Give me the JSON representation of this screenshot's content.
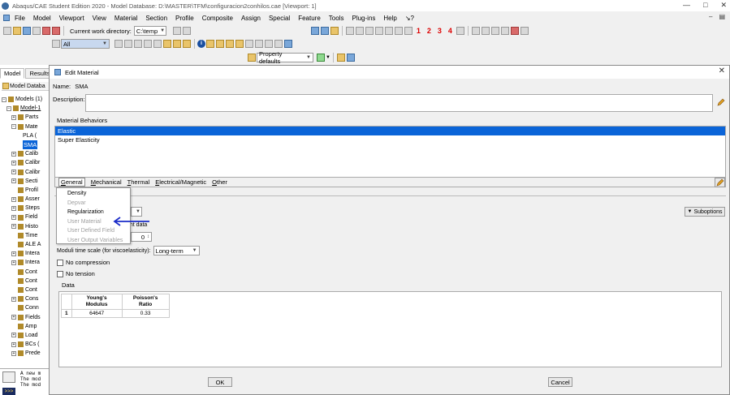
{
  "window": {
    "title": "Abaqus/CAE Student Edition 2020 - Model Database: D:\\MASTER\\TFM\\configuracion2conhilos.cae [Viewport: 1]"
  },
  "menu": [
    "File",
    "Model",
    "Viewport",
    "View",
    "Material",
    "Section",
    "Profile",
    "Composite",
    "Assign",
    "Special",
    "Feature",
    "Tools",
    "Plug-ins",
    "Help",
    "↘?"
  ],
  "toolbar": {
    "workdir_label": "Current work directory:",
    "workdir_value": "C:\\temp",
    "filter_value": "All",
    "property_defaults": "Property defaults",
    "view_numbers": [
      "1",
      "2",
      "3",
      "4"
    ]
  },
  "left_panel": {
    "tabs": [
      "Model",
      "Results"
    ],
    "header": "Model Databa",
    "tree": [
      {
        "pm": "−",
        "label": "Models (1)",
        "indent": 0
      },
      {
        "pm": "−",
        "label": "Model-1",
        "indent": 1
      },
      {
        "pm": "+",
        "label": "Parts",
        "indent": 2
      },
      {
        "pm": "−",
        "label": "Mate",
        "indent": 2
      },
      {
        "pm": "",
        "label": "PLA (",
        "indent": 3
      },
      {
        "pm": "",
        "label": "SMA",
        "indent": 3,
        "selected": true
      },
      {
        "pm": "+",
        "label": "Calib",
        "indent": 2
      },
      {
        "pm": "+",
        "label": "Calibr",
        "indent": 2
      },
      {
        "pm": "+",
        "label": "Calibr",
        "indent": 2
      },
      {
        "pm": "+",
        "label": "Secti",
        "indent": 2
      },
      {
        "pm": "",
        "label": "Profil",
        "indent": 2
      },
      {
        "pm": "+",
        "label": "Asser",
        "indent": 2
      },
      {
        "pm": "+",
        "label": "Steps",
        "indent": 2
      },
      {
        "pm": "+",
        "label": "Field",
        "indent": 2
      },
      {
        "pm": "+",
        "label": "Histo",
        "indent": 2
      },
      {
        "pm": "",
        "label": "Time",
        "indent": 2
      },
      {
        "pm": "",
        "label": "ALE A",
        "indent": 2
      },
      {
        "pm": "+",
        "label": "Intera",
        "indent": 2
      },
      {
        "pm": "+",
        "label": "Intera",
        "indent": 2
      },
      {
        "pm": "",
        "label": "Cont",
        "indent": 2
      },
      {
        "pm": "",
        "label": "Cont",
        "indent": 2
      },
      {
        "pm": "",
        "label": "Cont",
        "indent": 2
      },
      {
        "pm": "+",
        "label": "Cons",
        "indent": 2
      },
      {
        "pm": "",
        "label": "Conn",
        "indent": 2
      },
      {
        "pm": "+",
        "label": "Fields",
        "indent": 2
      },
      {
        "pm": "",
        "label": "Amp",
        "indent": 2
      },
      {
        "pm": "+",
        "label": "Load",
        "indent": 2
      },
      {
        "pm": "+",
        "label": "BCs (",
        "indent": 2
      },
      {
        "pm": "+",
        "label": "Prede",
        "indent": 2
      }
    ],
    "message_lines": [
      "A new m",
      "The mod",
      "The mod"
    ]
  },
  "dialog": {
    "title": "Edit Material",
    "name_label": "Name:",
    "name_value": "SMA",
    "description_label": "Description:",
    "behaviors_label": "Material Behaviors",
    "behaviors": [
      {
        "label": "Elastic",
        "selected": true
      },
      {
        "label": "Super Elasticity",
        "selected": false
      }
    ],
    "menus": [
      {
        "pre": "",
        "u": "G",
        "post": "eneral"
      },
      {
        "pre": "",
        "u": "M",
        "post": "echanical"
      },
      {
        "pre": "",
        "u": "T",
        "post": "hermal"
      },
      {
        "pre": "",
        "u": "E",
        "post": "lectrical/Magnetic"
      },
      {
        "pre": "",
        "u": "O",
        "post": "ther"
      }
    ],
    "general_dropdown": [
      {
        "label": "Density",
        "enabled": true
      },
      {
        "label": "Depvar",
        "enabled": false
      },
      {
        "label": "Regularization",
        "enabled": true
      },
      {
        "label": "User Material",
        "enabled": false
      },
      {
        "label": "User Defined Field",
        "enabled": false
      },
      {
        "label": "User Output Variables",
        "enabled": false
      }
    ],
    "partial_text": "ent data",
    "spin_value": "0",
    "suboptions_label": "Suboptions",
    "moduli_label": "Moduli time scale (for viscoelasticity):",
    "moduli_value": "Long-term",
    "no_compression": "No compression",
    "no_tension": "No tension",
    "data_label": "Data",
    "table": {
      "headers": [
        "Young's\nModulus",
        "Poisson's\nRatio"
      ],
      "rows": [
        {
          "index": "1",
          "values": [
            "64647",
            "0.33"
          ]
        }
      ]
    },
    "ok_label": "OK",
    "cancel_label": "Cancel"
  },
  "colors": {
    "selection": "#0a64d8",
    "arrow": "#1a2bc8"
  }
}
